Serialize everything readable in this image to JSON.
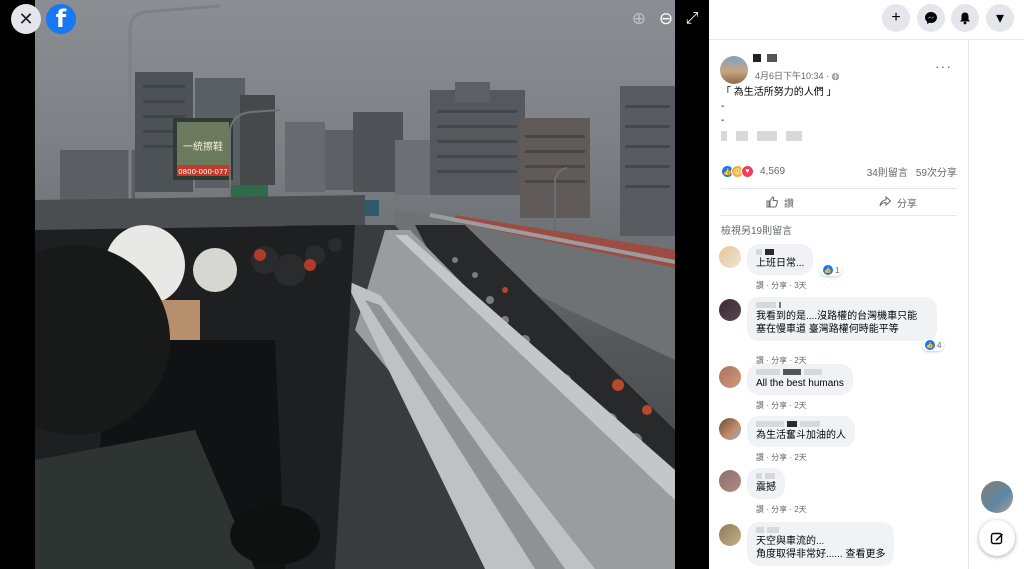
{
  "viewer": {
    "close_icon": "close-icon",
    "logo_text": "f",
    "zoom_in_icon": "zoom-in-icon",
    "zoom_out_icon": "zoom-out-icon",
    "fullscreen_icon": "fullscreen-icon",
    "photo_sign_text": "一統擦鞋",
    "photo_sign_phone": "0800-000-077"
  },
  "topbar": {
    "icons": [
      "plus-icon",
      "messenger-icon",
      "notifications-icon",
      "chevron-down-icon"
    ],
    "plus": "+",
    "chevron": "▾"
  },
  "post": {
    "timestamp": "4月6日下午10:34 · ",
    "privacy_icon": "globe-icon",
    "more": "···",
    "caption_line1": "「 為生活所努力的人們 」",
    "caption_line2": "-",
    "caption_line3": "-",
    "reaction_count": "4,569",
    "comments_count": "34則留言",
    "shares_count": "59次分享",
    "like_action": "讚",
    "share_action": "分享",
    "view_more_comments": "檢視另19則留言"
  },
  "comments": [
    {
      "text": "上班日常...",
      "meta": "讚 · 分享 · 3天",
      "likes": "1"
    },
    {
      "text_line1": "我看到的是....沒路權的台灣機車只能",
      "text_line2": "塞在慢車道 臺灣路權何時能平等",
      "meta": "讚 · 分享 · 2天",
      "likes": "4"
    },
    {
      "text": "All the best humans",
      "meta": "讚 · 分享 · 2天"
    },
    {
      "text": "為生活奮斗加油的人",
      "meta": "讚 · 分享 · 2天"
    },
    {
      "text": "震撼",
      "meta": "讚 · 分享 · 2天"
    },
    {
      "text_line1": "天空與車流的...",
      "text_line2": "角度取得非常好...... 查看更多"
    }
  ],
  "colors": {
    "facebook_blue": "#1877f2",
    "bubble_gray": "#f0f2f5",
    "meta_gray": "#65676b",
    "love_red": "#f33e58"
  }
}
